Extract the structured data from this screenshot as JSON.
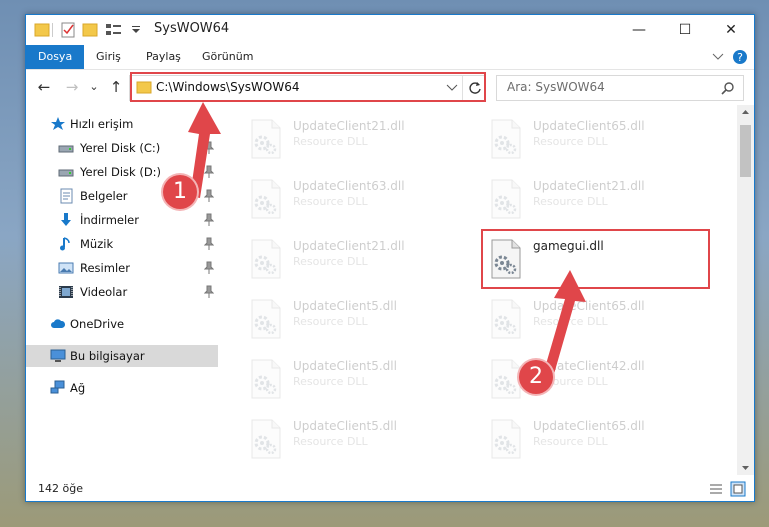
{
  "window": {
    "title": "SysWOW64",
    "min_glyph": "—",
    "max_glyph": "☐",
    "close_glyph": "✕"
  },
  "ribbon": {
    "tabs": [
      "Dosya",
      "Giriş",
      "Paylaş",
      "Görünüm"
    ],
    "active_tab": "Dosya",
    "accent_color": "#1979ca"
  },
  "nav": {
    "back_glyph": "←",
    "forward_glyph": "→",
    "recent_glyph": "⌄",
    "up_glyph": "↑",
    "address": "C:\\Windows\\SysWOW64",
    "search_placeholder": "Ara: SysWOW64"
  },
  "sidebar": {
    "items": [
      {
        "label": "Hızlı erişim",
        "icon": "star-icon"
      },
      {
        "label": "Yerel Disk (C:)",
        "icon": "drive-icon"
      },
      {
        "label": "Yerel Disk (D:)",
        "icon": "drive-icon"
      },
      {
        "label": "Belgeler",
        "icon": "documents-icon"
      },
      {
        "label": "İndirmeler",
        "icon": "downloads-icon"
      },
      {
        "label": "Müzik",
        "icon": "music-icon"
      },
      {
        "label": "Resimler",
        "icon": "pictures-icon"
      },
      {
        "label": "Videolar",
        "icon": "videos-icon"
      },
      {
        "label": "OneDrive",
        "icon": "cloud-icon"
      },
      {
        "label": "Bu bilgisayar",
        "icon": "computer-icon"
      },
      {
        "label": "Ağ",
        "icon": "network-icon"
      }
    ]
  },
  "files": [
    {
      "name": "UpdateClient21.dll",
      "type": "Resource DLL"
    },
    {
      "name": "UpdateClient65.dll",
      "type": "Resource DLL"
    },
    {
      "name": "UpdateClient63.dll",
      "type": "Resource DLL"
    },
    {
      "name": "UpdateClient21.dll",
      "type": "Resource DLL"
    },
    {
      "name": "UpdateClient21.dll",
      "type": "Resource DLL"
    },
    {
      "name": "gamegui.dll",
      "type": ""
    },
    {
      "name": "UpdateClient5.dll",
      "type": "Resource DLL"
    },
    {
      "name": "UpdateClient65.dll",
      "type": "Resource DLL"
    },
    {
      "name": "UpdateClient5.dll",
      "type": "Resource DLL"
    },
    {
      "name": "UpdateClient42.dll",
      "type": "Resource DLL"
    },
    {
      "name": "UpdateClient5.dll",
      "type": "Resource DLL"
    },
    {
      "name": "UpdateClient65.dll",
      "type": "Resource DLL"
    }
  ],
  "status": {
    "count": "142 öğe"
  },
  "annotations": {
    "step1": "1",
    "step2": "2",
    "color": "#e0464a"
  }
}
